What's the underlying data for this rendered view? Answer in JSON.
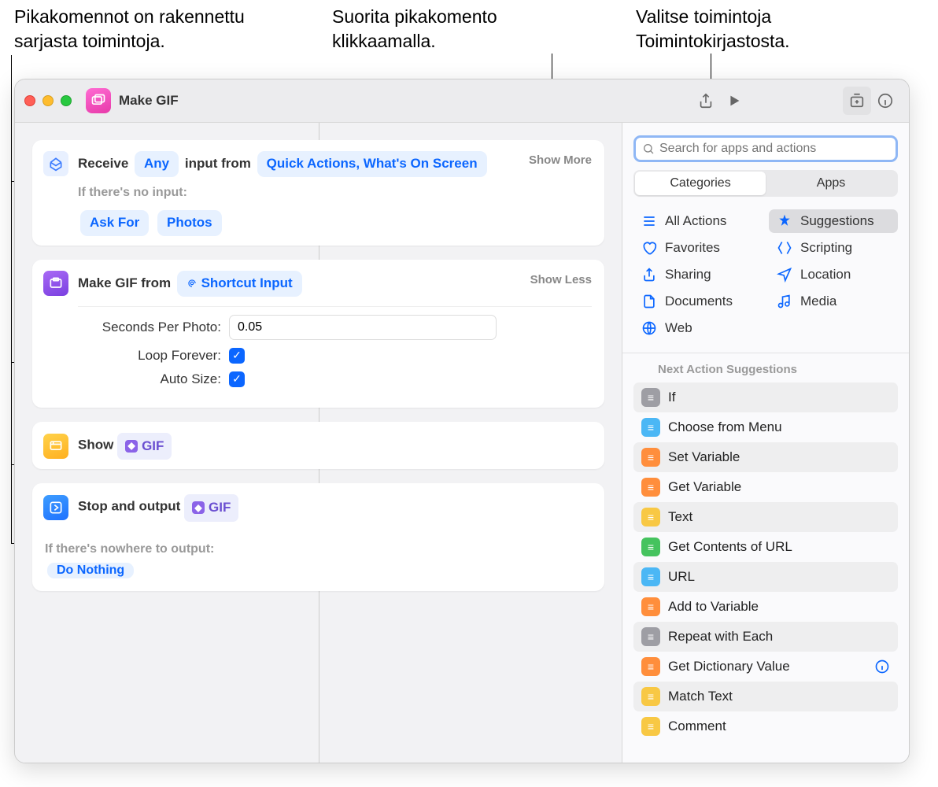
{
  "callouts": {
    "left": "Pikakomennot on rakennettu\nsarjasta toimintoja.",
    "middle": "Suorita pikakomento\nklikkaamalla.",
    "right": "Valitse toimintoja\nToimintokirjastosta."
  },
  "window": {
    "title": "Make GIF"
  },
  "actions": {
    "receive": {
      "prefix": "Receive",
      "any": "Any",
      "mid": "input from",
      "source": "Quick Actions, What's On Screen",
      "show_more": "Show More",
      "no_input_label": "If there's no input:",
      "ask_for": "Ask For",
      "photos": "Photos"
    },
    "makegif": {
      "prefix": "Make GIF from",
      "source": "Shortcut Input",
      "show_less": "Show Less",
      "seconds_label": "Seconds Per Photo:",
      "seconds_value": "0.05",
      "loop_label": "Loop Forever:",
      "autosize_label": "Auto Size:"
    },
    "show": {
      "label": "Show",
      "chip": "GIF"
    },
    "stop": {
      "label": "Stop and output",
      "chip": "GIF",
      "nowhere_label": "If there's nowhere to output:",
      "do_nothing": "Do Nothing"
    }
  },
  "sidebar": {
    "search_placeholder": "Search for apps and actions",
    "tabs": {
      "categories": "Categories",
      "apps": "Apps"
    },
    "categories": [
      {
        "name": "All Actions"
      },
      {
        "name": "Suggestions",
        "active": true
      },
      {
        "name": "Favorites"
      },
      {
        "name": "Scripting"
      },
      {
        "name": "Sharing"
      },
      {
        "name": "Location"
      },
      {
        "name": "Documents"
      },
      {
        "name": "Media"
      },
      {
        "name": "Web"
      }
    ],
    "suggestions_header": "Next Action Suggestions",
    "suggestions": [
      {
        "label": "If",
        "color": "#9e9ea4"
      },
      {
        "label": "Choose from Menu",
        "color": "#4bb7f5"
      },
      {
        "label": "Set Variable",
        "color": "#ff8e3c"
      },
      {
        "label": "Get Variable",
        "color": "#ff8e3c"
      },
      {
        "label": "Text",
        "color": "#f8c844"
      },
      {
        "label": "Get Contents of URL",
        "color": "#45c35e"
      },
      {
        "label": "URL",
        "color": "#4bb7f5"
      },
      {
        "label": "Add to Variable",
        "color": "#ff8e3c"
      },
      {
        "label": "Repeat with Each",
        "color": "#9e9ea4"
      },
      {
        "label": "Get Dictionary Value",
        "color": "#ff8e3c",
        "info": true
      },
      {
        "label": "Match Text",
        "color": "#f8c844"
      },
      {
        "label": "Comment",
        "color": "#f8c844"
      }
    ]
  }
}
